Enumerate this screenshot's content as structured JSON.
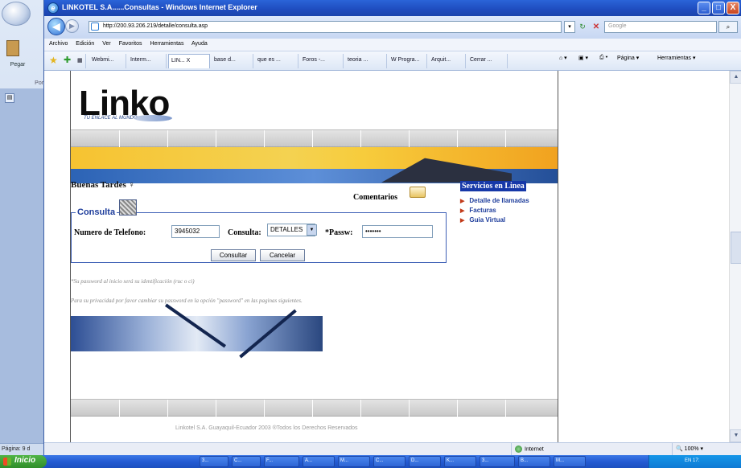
{
  "word": {
    "paste_label": "Pegar",
    "port_label": "Port",
    "status_text": "Página: 9 d"
  },
  "window": {
    "title": "LINKOTEL S.A......Consultas - Windows Internet Explorer",
    "minimize": "_",
    "maximize": "□",
    "close": "X"
  },
  "address": {
    "url": "http://200.93.206.219/detalle/consulta.asp",
    "search_placeholder": "Google"
  },
  "menu": [
    "Archivo",
    "Edición",
    "Ver",
    "Favoritos",
    "Herramientas",
    "Ayuda"
  ],
  "tabs": [
    {
      "label": "Webmi..."
    },
    {
      "label": "Interm..."
    },
    {
      "label": "LIN... X",
      "active": true
    },
    {
      "label": "base d..."
    },
    {
      "label": "que es ..."
    },
    {
      "label": "Foros -..."
    },
    {
      "label": "teoria ..."
    },
    {
      "label": "W Progra..."
    },
    {
      "label": "Arquit..."
    },
    {
      "label": "Cerrar ..."
    }
  ],
  "toolbar_right": {
    "page": "Página",
    "tools": "Herramientas"
  },
  "page": {
    "logo": "Linko",
    "logo_tagline": "TU ENLACE AL MUNDO",
    "greeting": "Buenas Tardes",
    "comentarios": "Comentarios",
    "services": {
      "title": "Servicios en Linea",
      "items": [
        "Detalle de llamadas",
        "Facturas",
        "Guia Virtual"
      ]
    },
    "form": {
      "legend": "Consulta",
      "phone_label": "Numero de Telefono:",
      "phone_value": "3945032",
      "query_label": "Consulta:",
      "query_selected": "DETALLES",
      "pass_label": "*Passw:",
      "pass_value": "•••••••",
      "submit": "Consultar",
      "cancel": "Cancelar"
    },
    "note1": "*Su password al inicio será su identificación (ruc o ci)",
    "note2": "Para su privacidad por favor cambiar su password en la opción \"password\" en las paginas siguientes.",
    "footer": "Linkotel S.A. Guayaquil-Ecuador 2003 ®Todos los Derechos Reservados"
  },
  "status": {
    "zone": "Internet",
    "zoom": "100%"
  },
  "taskbar": {
    "start": "Inicio",
    "tasks": [
      "3...",
      "C...",
      "F...",
      "A...",
      "M...",
      "C...",
      "D...",
      "K...",
      "3...",
      "B...",
      "M..."
    ],
    "tray": "EN  17:"
  }
}
